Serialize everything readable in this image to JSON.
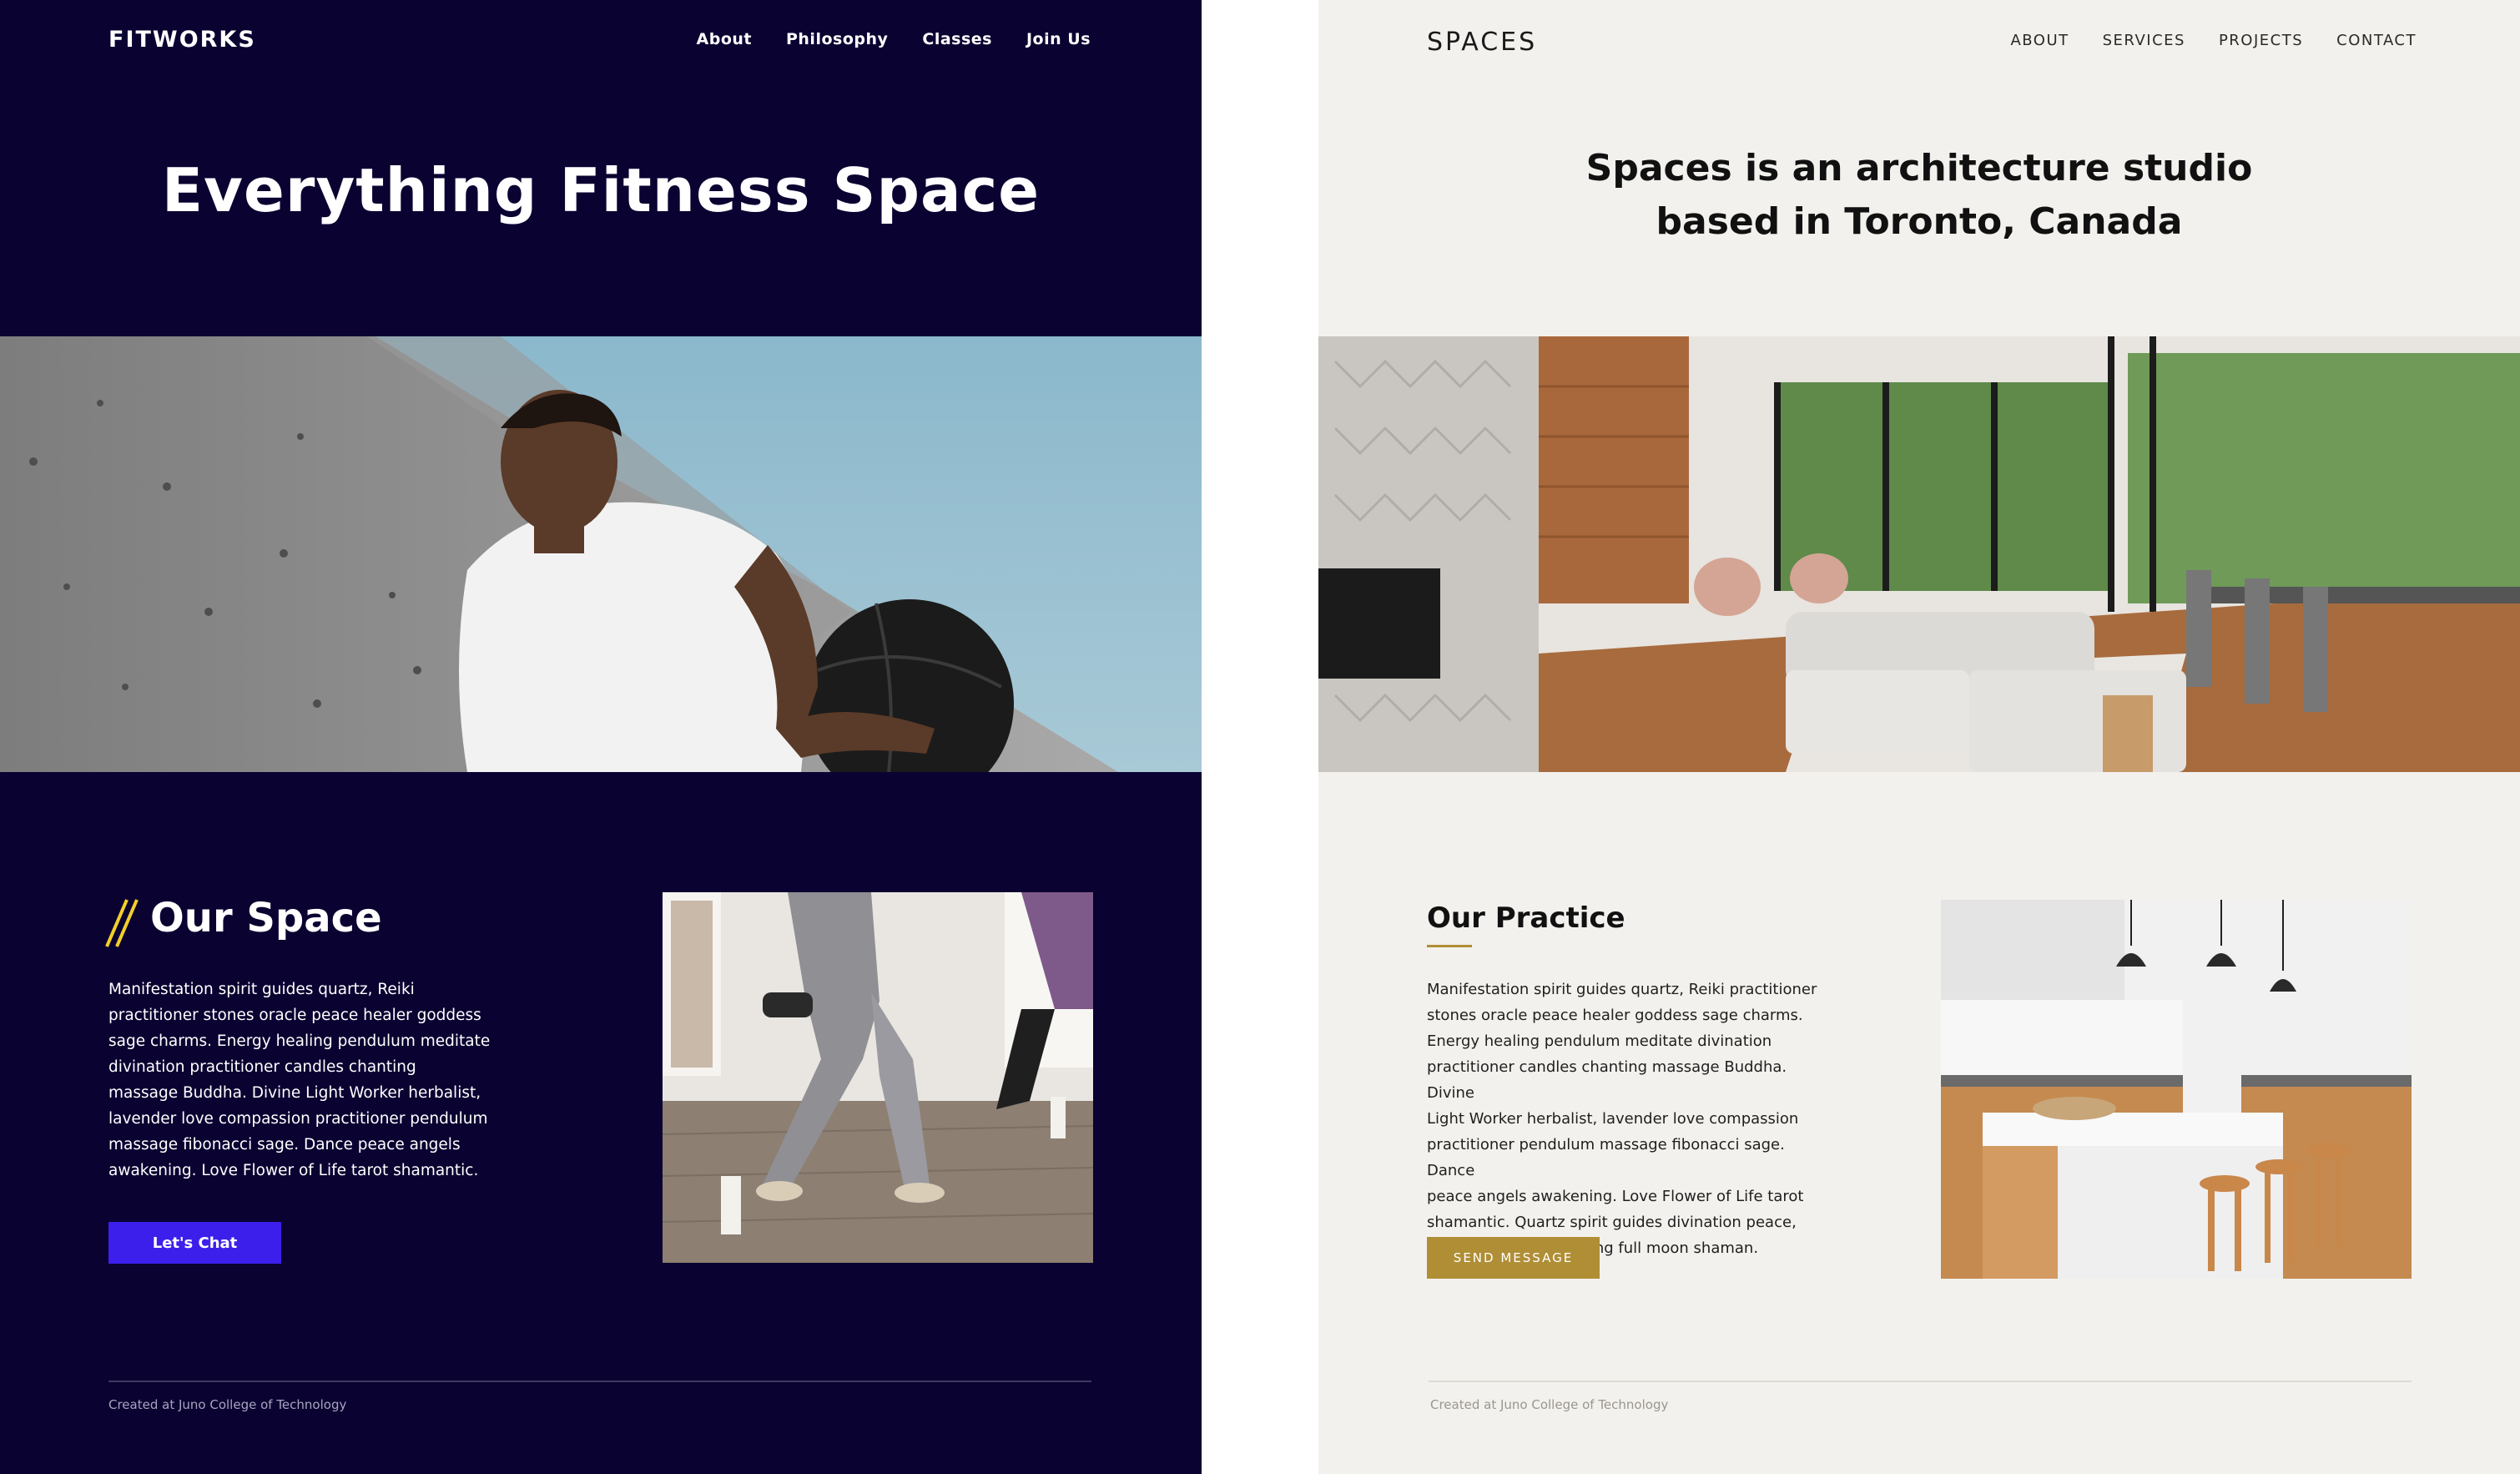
{
  "fitworks": {
    "logo": "FITWORKS",
    "nav": [
      "About",
      "Philosophy",
      "Classes",
      "Join Us"
    ],
    "hero_title": "Everything Fitness Space",
    "section_title": "Our Space",
    "body_lines": [
      "Manifestation spirit guides quartz, Reiki",
      "practitioner stones oracle peace healer goddess",
      "sage charms. Energy healing pendulum meditate",
      "divination practitioner candles chanting",
      "massage Buddha. Divine Light Worker herbalist,",
      "lavender love compassion practitioner pendulum",
      "massage fibonacci sage. Dance peace angels",
      "awakening. Love Flower of Life tarot shamantic."
    ],
    "button_label": "Let's Chat",
    "footer": "Created at Juno College of Technology",
    "colors": {
      "background": "#0a0231",
      "button": "#3d1fec",
      "accent": "#f2cf2b"
    }
  },
  "spaces": {
    "logo": "SPACES",
    "nav": [
      "ABOUT",
      "SERVICES",
      "PROJECTS",
      "CONTACT"
    ],
    "hero_title_lines": [
      "Spaces is an architecture studio",
      "based in Toronto, Canada"
    ],
    "section_title": "Our Practice",
    "body_lines": [
      "Manifestation spirit guides quartz, Reiki practitioner",
      "stones oracle peace healer goddess sage charms.",
      "Energy healing pendulum meditate divination",
      "practitioner candles chanting massage Buddha. Divine",
      "Light Worker herbalist, lavender love compassion",
      "practitioner pendulum massage fibonacci sage. Dance",
      "peace angels awakening. Love Flower of Life tarot",
      "shamantic. Quartz spirit guides divination peace,",
      "herbalist chakra clearing full moon shaman."
    ],
    "button_label": "SEND MESSAGE",
    "footer": "Created at Juno College of Technology",
    "colors": {
      "background": "#f3f1ed",
      "button": "#b08e35"
    }
  }
}
